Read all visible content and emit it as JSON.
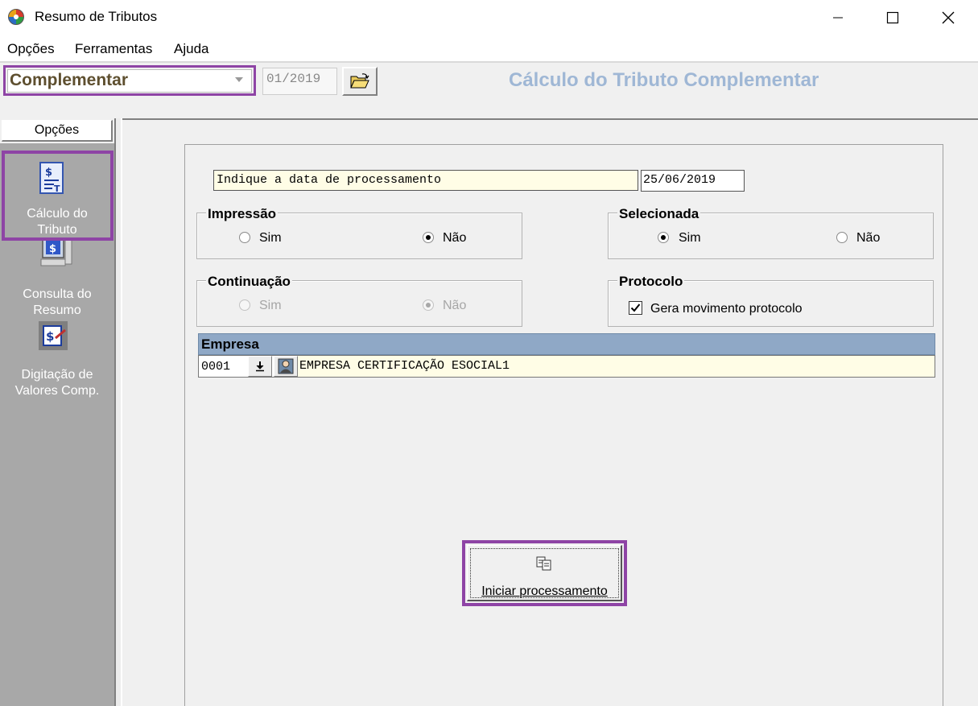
{
  "window": {
    "title": "Resumo de Tributos",
    "icon": "app-globe-icon"
  },
  "menu": {
    "items": [
      "Opções",
      "Ferramentas",
      "Ajuda"
    ]
  },
  "toolbar": {
    "calc_type": "Complementar",
    "period": "01/2019",
    "open_icon": "folder-open-icon",
    "header_title": "Cálculo do Tributo Complementar"
  },
  "sidebar": {
    "header": "Opções",
    "items": [
      {
        "label_line1": "Cálculo do",
        "label_line2": "Tributo",
        "icon": "tax-calc-document-icon",
        "selected": true
      },
      {
        "label_line1": "Consulta do",
        "label_line2": "Resumo",
        "icon": "tax-query-computer-icon",
        "selected": false
      },
      {
        "label_line1": "Digitação de",
        "label_line2": "Valores Comp.",
        "icon": "value-entry-icon",
        "selected": false
      }
    ]
  },
  "form": {
    "process_date_label": "Indique a data de processamento",
    "process_date": "25/06/2019",
    "impressao": {
      "title": "Impressão",
      "option_yes": "Sim",
      "option_no": "Não",
      "selected": "Não"
    },
    "selecionada": {
      "title": "Selecionada",
      "option_yes": "Sim",
      "option_no": "Não",
      "selected": "Sim"
    },
    "continuacao": {
      "title": "Continuação",
      "option_yes": "Sim",
      "option_no": "Não",
      "selected": "Não",
      "enabled": false
    },
    "protocolo": {
      "title": "Protocolo",
      "checkbox_label": "Gera movimento protocolo",
      "checked": true
    },
    "empresa": {
      "header": "Empresa",
      "code": "0001",
      "name": "EMPRESA CERTIFICAÇÃO ESOCIAL1"
    },
    "start_button": "Iniciar processamento"
  },
  "colors": {
    "highlight": "#8e44a5",
    "header_title": "#9fb7d5",
    "empresa_header": "#8fa8c6",
    "field_yellow": "#fffde6",
    "sidebar_bg": "#a8a8a8"
  }
}
